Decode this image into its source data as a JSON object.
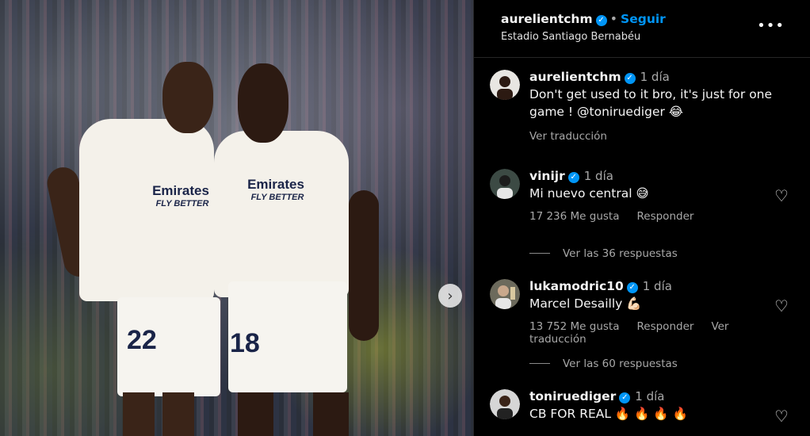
{
  "post": {
    "username": "aurelientchm",
    "follow_label": "Seguir",
    "location": "Estadio Santiago Bernabéu",
    "more_icon": "more-horizontal-icon"
  },
  "photo": {
    "jersey_sponsor": "Emirates",
    "jersey_tagline": "FLY BETTER",
    "number_left": "22",
    "number_right": "18",
    "next_icon": "chevron-right-icon"
  },
  "caption": {
    "username": "aurelientchm",
    "time": "1 día",
    "text": "Don't get used to it bro, it's just for one game ! @toniruediger 😂",
    "translate": "Ver traducción"
  },
  "comments": [
    {
      "username": "vinijr",
      "time": "1 día",
      "text": "Mi nuevo central 😅",
      "likes": "17 236 Me gusta",
      "reply": "Responder",
      "view_replies": "Ver las 36 respuestas"
    },
    {
      "username": "lukamodric10",
      "time": "1 día",
      "text": "Marcel Desailly 💪🏻",
      "likes": "13 752 Me gusta",
      "reply": "Responder",
      "translate": "Ver traducción",
      "view_replies": "Ver las 60 respuestas"
    },
    {
      "username": "toniruediger",
      "time": "1 día",
      "text": "CB FOR REAL 🔥 🔥 🔥 🔥"
    }
  ],
  "colors": {
    "accent": "#0095f6",
    "muted": "#a8a8a8",
    "background": "#000000"
  }
}
